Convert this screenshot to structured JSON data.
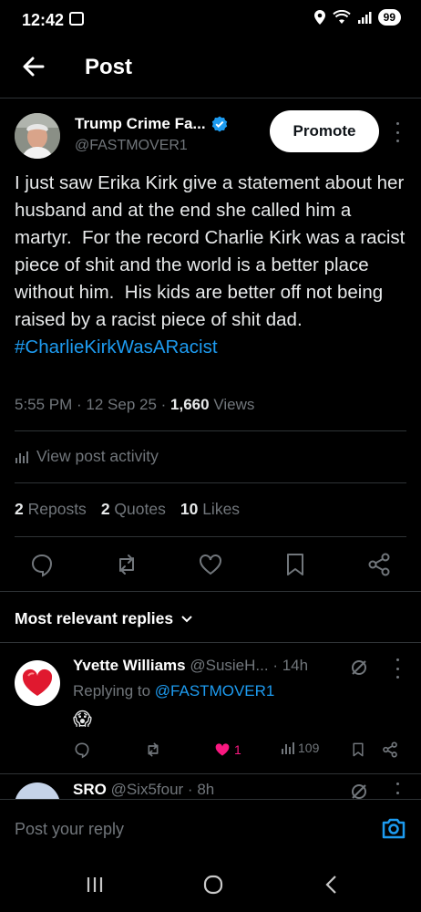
{
  "status_bar": {
    "time": "12:42",
    "battery": "99"
  },
  "header": {
    "title": "Post"
  },
  "post": {
    "author_name": "Trump Crime Fa...",
    "handle": "@FASTMOVER1",
    "promote_label": "Promote",
    "text": "I just saw Erika Kirk give a statement about her husband and at the end she called him a martyr.  For the record Charlie Kirk was a racist piece of shit and the world is a better place without him.  His kids are better off not being raised by a racist piece of shit dad.",
    "hashtag": "#CharlieKirkWasARacist",
    "time": "5:55 PM",
    "date": "12 Sep 25",
    "views_count": "1,660",
    "views_label": "Views",
    "activity_label": "View post activity",
    "reposts_count": "2",
    "reposts_label": "Reposts",
    "quotes_count": "2",
    "quotes_label": "Quotes",
    "likes_count": "10",
    "likes_label": "Likes"
  },
  "replies_section": {
    "title": "Most relevant replies"
  },
  "reply1": {
    "name": "Yvette Williams",
    "handle": "@SusieH...",
    "time": "14h",
    "replying_prefix": "Replying to",
    "replying_handle": "@FASTMOVER1",
    "emoji": "😱",
    "likes": "1",
    "views": "109",
    "like_color": "#f91880"
  },
  "reply2": {
    "name": "SRO",
    "handle": "@Six5four",
    "time": "8h"
  },
  "composer": {
    "placeholder": "Post your reply"
  },
  "colors": {
    "accent": "#1d9bf0",
    "background": "#000000",
    "muted": "#71767b",
    "divider": "#2f3336"
  }
}
